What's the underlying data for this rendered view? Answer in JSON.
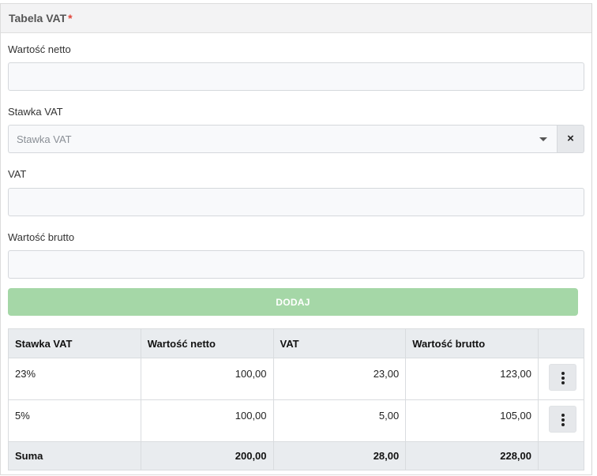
{
  "panel": {
    "title": "Tabela VAT",
    "required_mark": "*"
  },
  "form": {
    "net_label": "Wartość netto",
    "net_value": "",
    "rate_label": "Stawka VAT",
    "rate_placeholder": "Stawka VAT",
    "rate_clear": "×",
    "vat_label": "VAT",
    "vat_value": "",
    "gross_label": "Wartość brutto",
    "gross_value": "",
    "add_label": "DODAJ"
  },
  "table": {
    "headers": [
      "Stawka VAT",
      "Wartość netto",
      "VAT",
      "Wartość brutto",
      ""
    ],
    "rows": [
      {
        "rate": "23%",
        "net": "100,00",
        "vat": "23,00",
        "gross": "123,00"
      },
      {
        "rate": "5%",
        "net": "100,00",
        "vat": "5,00",
        "gross": "105,00"
      }
    ],
    "sum": {
      "label": "Suma",
      "net": "200,00",
      "vat": "28,00",
      "gross": "228,00"
    }
  },
  "icons": {
    "row_menu": "kebab-vertical-icon",
    "caret": "caret-down-icon",
    "clear": "close-icon"
  },
  "colors": {
    "add_button": "#a5d7a7",
    "required": "#e0453a",
    "header_bg": "#e9ecef"
  }
}
